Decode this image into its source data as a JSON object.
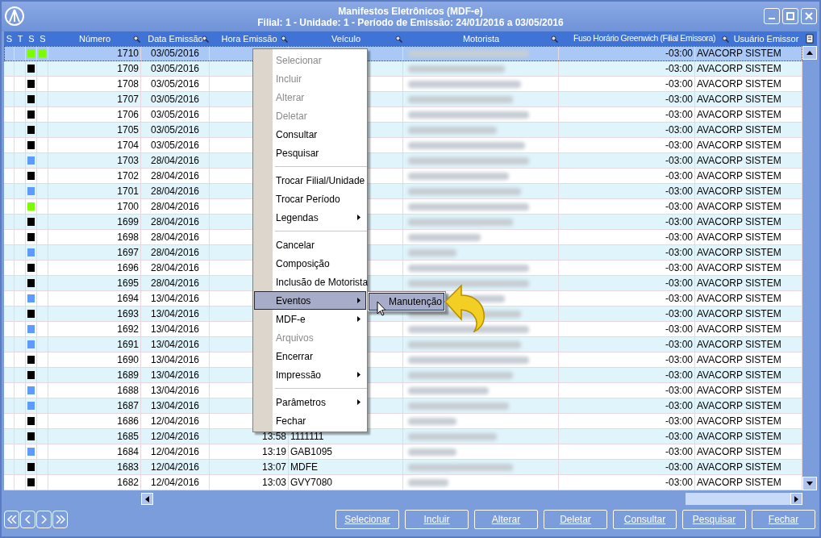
{
  "window": {
    "title": "Manifestos Eletrônicos (MDF-e)",
    "subtitle": "Filial: 1 - Unidade: 1 - Período de Emissão: 24/01/2016 a 03/05/2016"
  },
  "table": {
    "columns": [
      "S",
      "T",
      "S",
      "S",
      "Número",
      "Data Emissão",
      "Hora Emissão",
      "Veículo",
      "Motorista",
      "Fuso Horário Greenwich (Filial Emissora)",
      "Usuário Emissor"
    ],
    "rows": [
      {
        "number": "1710",
        "date": "03/05/2016",
        "indicators": [
          {
            "color": "#7cfc00"
          },
          {
            "color": "#7cfc00"
          }
        ],
        "fuso": "-03:00",
        "user": "AVACORP SISTEM",
        "selected": true
      },
      {
        "number": "1709",
        "date": "03/05/2016",
        "indicators": [
          {
            "color": "#000000"
          }
        ],
        "fuso": "-03:00",
        "user": "AVACORP SISTEM",
        "selected": false
      },
      {
        "number": "1708",
        "date": "03/05/2016",
        "indicators": [
          {
            "color": "#000000"
          }
        ],
        "fuso": "-03:00",
        "user": "AVACORP SISTEM",
        "selected": false
      },
      {
        "number": "1707",
        "date": "03/05/2016",
        "indicators": [
          {
            "color": "#000000"
          }
        ],
        "fuso": "-03:00",
        "user": "AVACORP SISTEM",
        "selected": false
      },
      {
        "number": "1706",
        "date": "03/05/2016",
        "indicators": [
          {
            "color": "#000000"
          }
        ],
        "fuso": "-03:00",
        "user": "AVACORP SISTEM",
        "selected": false
      },
      {
        "number": "1705",
        "date": "03/05/2016",
        "indicators": [
          {
            "color": "#000000"
          }
        ],
        "fuso": "-03:00",
        "user": "AVACORP SISTEM",
        "selected": false
      },
      {
        "number": "1704",
        "date": "03/05/2016",
        "indicators": [
          {
            "color": "#000000"
          }
        ],
        "fuso": "-03:00",
        "user": "AVACORP SISTEM",
        "selected": false
      },
      {
        "number": "1703",
        "date": "28/04/2016",
        "indicators": [
          {
            "color": "#5f9bff"
          }
        ],
        "fuso": "-03:00",
        "user": "AVACORP SISTEM",
        "selected": false
      },
      {
        "number": "1702",
        "date": "28/04/2016",
        "indicators": [
          {
            "color": "#000000"
          }
        ],
        "fuso": "-03:00",
        "user": "AVACORP SISTEM",
        "selected": false
      },
      {
        "number": "1701",
        "date": "28/04/2016",
        "indicators": [
          {
            "color": "#5f9bff"
          }
        ],
        "fuso": "-03:00",
        "user": "AVACORP SISTEM",
        "selected": false
      },
      {
        "number": "1700",
        "date": "28/04/2016",
        "indicators": [
          {
            "color": "#7cfc00"
          }
        ],
        "fuso": "-03:00",
        "user": "AVACORP SISTEM",
        "selected": false
      },
      {
        "number": "1699",
        "date": "28/04/2016",
        "indicators": [
          {
            "color": "#000000"
          }
        ],
        "fuso": "-03:00",
        "user": "AVACORP SISTEM",
        "selected": false
      },
      {
        "number": "1698",
        "date": "28/04/2016",
        "indicators": [
          {
            "color": "#000000"
          }
        ],
        "fuso": "-03:00",
        "user": "AVACORP SISTEM",
        "selected": false
      },
      {
        "number": "1697",
        "date": "28/04/2016",
        "indicators": [
          {
            "color": "#5f9bff"
          }
        ],
        "fuso": "-03:00",
        "user": "AVACORP SISTEM",
        "selected": false
      },
      {
        "number": "1696",
        "date": "28/04/2016",
        "indicators": [
          {
            "color": "#000000"
          }
        ],
        "fuso": "-03:00",
        "user": "AVACORP SISTEM",
        "selected": false
      },
      {
        "number": "1695",
        "date": "28/04/2016",
        "indicators": [
          {
            "color": "#000000"
          }
        ],
        "fuso": "-03:00",
        "user": "AVACORP SISTEM",
        "selected": false
      },
      {
        "number": "1694",
        "date": "13/04/2016",
        "indicators": [
          {
            "color": "#5f9bff"
          }
        ],
        "fuso": "-03:00",
        "user": "AVACORP SISTEM",
        "selected": false
      },
      {
        "number": "1693",
        "date": "13/04/2016",
        "indicators": [
          {
            "color": "#000000"
          }
        ],
        "fuso": "-03:00",
        "user": "AVACORP SISTEM",
        "selected": false
      },
      {
        "number": "1692",
        "date": "13/04/2016",
        "indicators": [
          {
            "color": "#5f9bff"
          }
        ],
        "fuso": "-03:00",
        "user": "AVACORP SISTEM",
        "selected": false
      },
      {
        "number": "1691",
        "date": "13/04/2016",
        "indicators": [
          {
            "color": "#5f9bff"
          }
        ],
        "fuso": "-03:00",
        "user": "AVACORP SISTEM",
        "selected": false
      },
      {
        "number": "1690",
        "date": "13/04/2016",
        "indicators": [
          {
            "color": "#000000"
          }
        ],
        "fuso": "-03:00",
        "user": "AVACORP SISTEM",
        "selected": false
      },
      {
        "number": "1689",
        "date": "13/04/2016",
        "indicators": [
          {
            "color": "#000000"
          }
        ],
        "fuso": "-03:00",
        "user": "AVACORP SISTEM",
        "selected": false
      },
      {
        "number": "1688",
        "date": "13/04/2016",
        "indicators": [
          {
            "color": "#5f9bff"
          }
        ],
        "fuso": "-03:00",
        "user": "AVACORP SISTEM",
        "selected": false
      },
      {
        "number": "1687",
        "date": "13/04/2016",
        "indicators": [
          {
            "color": "#5f9bff"
          }
        ],
        "fuso": "-03:00",
        "user": "AVACORP SISTEM",
        "selected": false
      },
      {
        "number": "1686",
        "date": "12/04/2016",
        "indicators": [
          {
            "color": "#000000"
          }
        ],
        "fuso": "-03:00",
        "user": "AVACORP SISTEM",
        "selected": false
      },
      {
        "number": "1685",
        "date": "12/04/2016",
        "time": "13:58",
        "vehicle": "1111111",
        "indicators": [
          {
            "color": "#000000"
          }
        ],
        "fuso": "-03:00",
        "user": "AVACORP SISTEM",
        "selected": false
      },
      {
        "number": "1684",
        "date": "12/04/2016",
        "time": "13:19",
        "vehicle": "GAB1095",
        "indicators": [
          {
            "color": "#5f9bff"
          }
        ],
        "fuso": "-03:00",
        "user": "AVACORP SISTEM",
        "selected": false
      },
      {
        "number": "1683",
        "date": "12/04/2016",
        "time": "13:07",
        "vehicle": "MDFE",
        "indicators": [
          {
            "color": "#000000"
          }
        ],
        "fuso": "-03:00",
        "user": "AVACORP SISTEM",
        "selected": false
      },
      {
        "number": "1682",
        "date": "12/04/2016",
        "time": "13:03",
        "vehicle": "GVY7080",
        "indicators": [
          {
            "color": "#000000"
          }
        ],
        "fuso": "-03:00",
        "user": "AVACORP SISTEM",
        "selected": false
      }
    ]
  },
  "context_menu": {
    "items": [
      {
        "kind": "item",
        "label": "Selecionar",
        "disabled": true,
        "submenu": false,
        "selected": false
      },
      {
        "kind": "item",
        "label": "Incluir",
        "disabled": true,
        "submenu": false,
        "selected": false
      },
      {
        "kind": "item",
        "label": "Alterar",
        "disabled": true,
        "submenu": false,
        "selected": false
      },
      {
        "kind": "item",
        "label": "Deletar",
        "disabled": true,
        "submenu": false,
        "selected": false
      },
      {
        "kind": "item",
        "label": "Consultar",
        "disabled": false,
        "submenu": false,
        "selected": false
      },
      {
        "kind": "item",
        "label": "Pesquisar",
        "disabled": false,
        "submenu": false,
        "selected": false
      },
      {
        "kind": "separator"
      },
      {
        "kind": "item",
        "label": "Trocar Filial/Unidade",
        "disabled": false,
        "submenu": false,
        "selected": false
      },
      {
        "kind": "item",
        "label": "Trocar Período",
        "disabled": false,
        "submenu": false,
        "selected": false
      },
      {
        "kind": "item",
        "label": "Legendas",
        "disabled": false,
        "submenu": true,
        "selected": false
      },
      {
        "kind": "separator"
      },
      {
        "kind": "item",
        "label": "Cancelar",
        "disabled": false,
        "submenu": false,
        "selected": false
      },
      {
        "kind": "item",
        "label": "Composição",
        "disabled": false,
        "submenu": false,
        "selected": false
      },
      {
        "kind": "item",
        "label": "Inclusão de Motorista",
        "disabled": false,
        "submenu": false,
        "selected": false
      },
      {
        "kind": "item",
        "label": "Eventos",
        "disabled": false,
        "submenu": true,
        "selected": true
      },
      {
        "kind": "item",
        "label": "MDF-e",
        "disabled": false,
        "submenu": true,
        "selected": false
      },
      {
        "kind": "item",
        "label": "Arquivos",
        "disabled": true,
        "submenu": false,
        "selected": false
      },
      {
        "kind": "item",
        "label": "Encerrar",
        "disabled": false,
        "submenu": false,
        "selected": false
      },
      {
        "kind": "item",
        "label": "Impressão",
        "disabled": false,
        "submenu": true,
        "selected": false
      },
      {
        "kind": "separator"
      },
      {
        "kind": "item",
        "label": "Parâmetros",
        "disabled": false,
        "submenu": true,
        "selected": false
      },
      {
        "kind": "item",
        "label": "Fechar",
        "disabled": false,
        "submenu": false,
        "selected": false
      }
    ],
    "submenu": {
      "items": [
        {
          "label": "Manutenção",
          "selected": true
        }
      ]
    }
  },
  "buttons": [
    "Selecionar",
    "Incluir",
    "Alterar",
    "Deletar",
    "Consultar",
    "Pesquisar",
    "Fechar"
  ]
}
